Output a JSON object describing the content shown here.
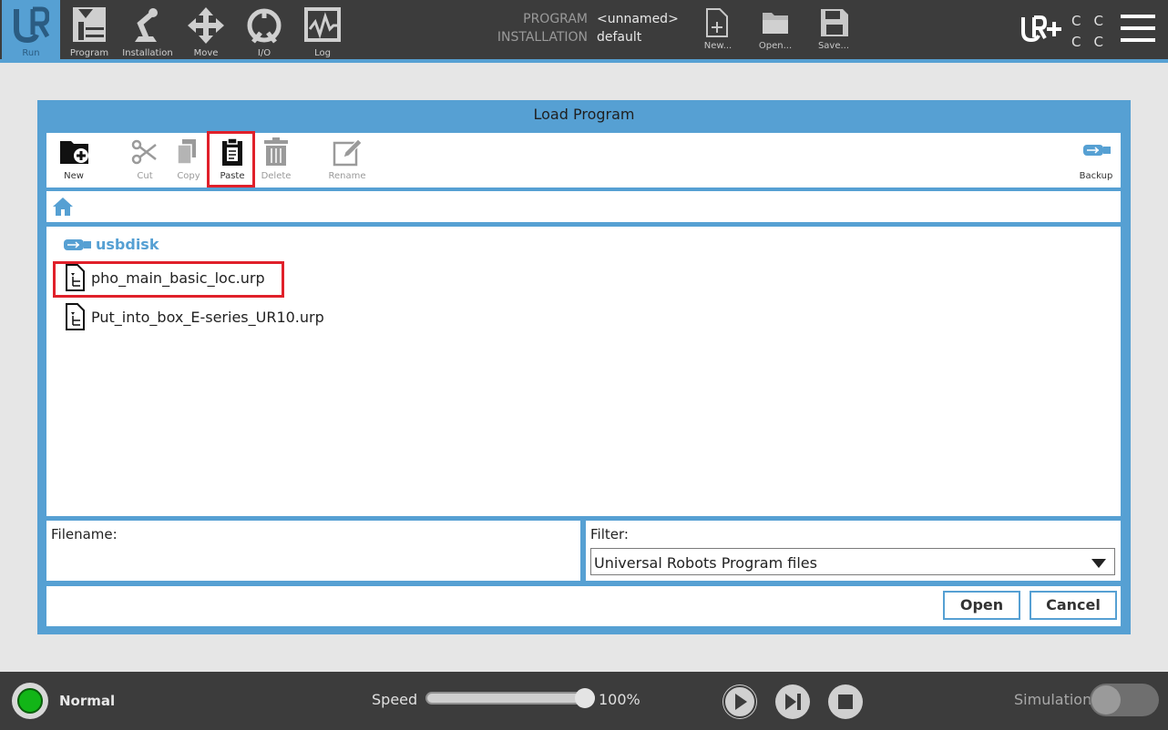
{
  "topbar": {
    "nav": [
      {
        "label": "Run",
        "icon": "ur-logo-icon",
        "active": true
      },
      {
        "label": "Program",
        "icon": "program-icon"
      },
      {
        "label": "Installation",
        "icon": "robot-arm-icon"
      },
      {
        "label": "Move",
        "icon": "move-arrows-icon"
      },
      {
        "label": "I/O",
        "icon": "io-icon"
      },
      {
        "label": "Log",
        "icon": "log-waveform-icon"
      }
    ],
    "program_label": "PROGRAM",
    "program_value": "<unnamed>",
    "installation_label": "INSTALLATION",
    "installation_value": "default",
    "file_buttons": [
      {
        "label": "New...",
        "icon": "new-file-icon"
      },
      {
        "label": "Open...",
        "icon": "open-folder-icon"
      },
      {
        "label": "Save...",
        "icon": "save-disk-icon"
      }
    ],
    "cc_text": "CC CC"
  },
  "dialog": {
    "title": "Load Program",
    "toolbar": [
      {
        "label": "New",
        "icon": "new-folder-icon",
        "enabled": true
      },
      {
        "label": "Cut",
        "icon": "scissors-icon",
        "enabled": false
      },
      {
        "label": "Copy",
        "icon": "copy-icon",
        "enabled": false
      },
      {
        "label": "Paste",
        "icon": "clipboard-icon",
        "enabled": true,
        "highlighted": true
      },
      {
        "label": "Delete",
        "icon": "trash-icon",
        "enabled": false
      },
      {
        "label": "Rename",
        "icon": "pencil-icon",
        "enabled": false
      },
      {
        "label": "Backup",
        "icon": "usb-icon",
        "enabled": true
      }
    ],
    "location": "usbdisk",
    "files": [
      {
        "name": "pho_main_basic_loc.urp",
        "highlighted": true
      },
      {
        "name": "Put_into_box_E-series_UR10.urp",
        "highlighted": false
      }
    ],
    "filename_label": "Filename:",
    "filename_value": "",
    "filter_label": "Filter:",
    "filter_value": "Universal Robots Program files",
    "open_label": "Open",
    "cancel_label": "Cancel"
  },
  "footer": {
    "status": "Normal",
    "status_color": "#12b517",
    "speed_label": "Speed",
    "speed_value": "100%",
    "speed_fraction": 1.0,
    "simulation_label": "Simulation",
    "simulation_on": false
  },
  "colors": {
    "accent": "#56a0d3",
    "highlight": "#e0202a",
    "topbar": "#3c3c3c"
  }
}
